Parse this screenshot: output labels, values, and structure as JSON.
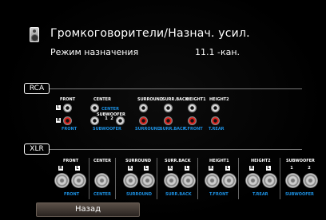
{
  "title": "Громкоговорители/Назнач. усил.",
  "mode": {
    "label": "Режим назначения",
    "value": "11.1 -кан."
  },
  "rca": {
    "tag": "RCA",
    "headers": [
      "FRONT",
      "CENTER",
      "SUBWOOFER",
      "SURROUND",
      "SURR.BACK",
      "HEIGHT1",
      "HEIGHT2"
    ],
    "labels": [
      "FRONT",
      "CENTER",
      "SUBWOOFER",
      "SURROUND",
      "SURR.BACK",
      "T.FRONT",
      "T.REAR"
    ],
    "badges": {
      "l": "L",
      "r": "R",
      "sw1": "1",
      "sw2": "2"
    }
  },
  "xlr": {
    "tag": "XLR",
    "headers": [
      "FRONT",
      "CENTER",
      "SURROUND",
      "SURR.BACK",
      "HEIGHT1",
      "HEIGHT2",
      "SUBWOOFER"
    ],
    "labels": [
      "FRONT",
      "CENTER",
      "SURROUND",
      "SURR.BACK",
      "T.FRONT",
      "T.REAR",
      "SUBWOOFER"
    ],
    "badges": {
      "r": "R",
      "l": "L",
      "sw1": "1",
      "sw2": "2"
    }
  },
  "back_label": "Назад",
  "colors": {
    "accent": "#1c8fe0",
    "rca_red": "#e0201a",
    "background": "#000000"
  }
}
